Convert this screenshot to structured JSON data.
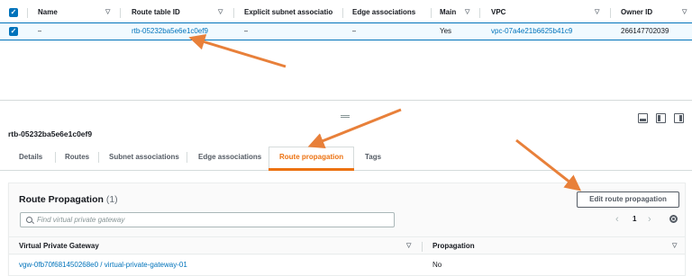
{
  "grid": {
    "columns": [
      "Name",
      "Route table ID",
      "Explicit subnet associatio",
      "Edge associations",
      "Main",
      "VPC",
      "Owner ID"
    ],
    "row": {
      "name": "–",
      "route_table_id": "rtb-05232ba5e6e1c0ef9",
      "explicit_subnet": "–",
      "edge_associations": "–",
      "main": "Yes",
      "vpc": "vpc-07a4e21b6625b41c9",
      "owner_id": "266147702039"
    }
  },
  "detail": {
    "title": "rtb-05232ba5e6e1c0ef9",
    "tabs": [
      "Details",
      "Routes",
      "Subnet associations",
      "Edge associations",
      "Route propagation",
      "Tags"
    ],
    "active_tab": "Route propagation"
  },
  "route_propagation": {
    "title": "Route Propagation",
    "count": "(1)",
    "edit_button": "Edit route propagation",
    "search_placeholder": "Find virtual private gateway",
    "page": "1",
    "columns": [
      "Virtual Private Gateway",
      "Propagation"
    ],
    "rows": [
      {
        "gateway": "vgw-0fb70f681450268e0 / virtual-private-gateway-01",
        "propagation": "No"
      }
    ]
  },
  "colors": {
    "accent": "#0073bb",
    "active_tab": "#ec7211",
    "annotation_arrow": "#e8803a"
  },
  "icons": [
    "checkbox-icon",
    "sort-icon",
    "search-icon",
    "chevron-left-icon",
    "chevron-right-icon",
    "settings-icon",
    "panel-bottom-icon",
    "panel-side-icon",
    "arrow-annotation"
  ]
}
